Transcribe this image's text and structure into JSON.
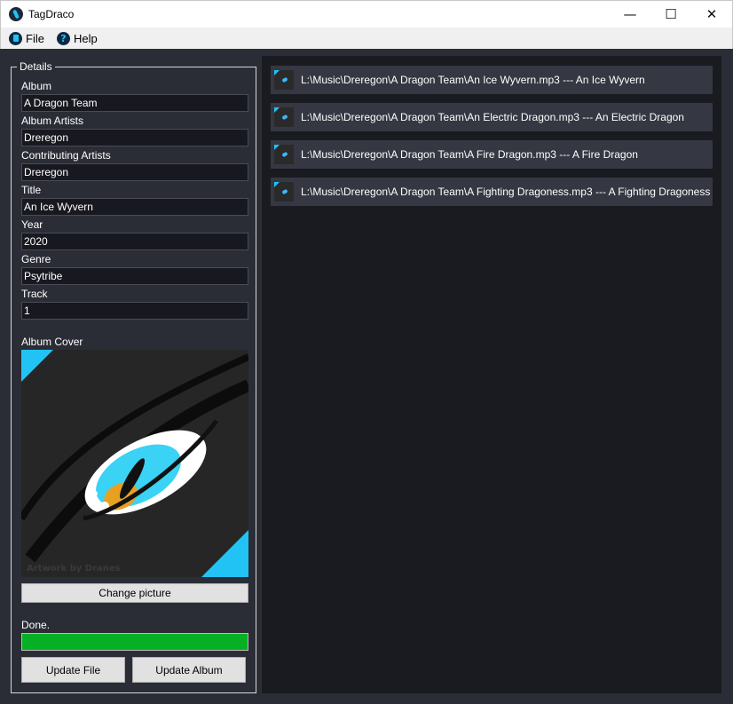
{
  "window": {
    "title": "TagDraco",
    "minimize": "—",
    "maximize": "☐",
    "close": "✕"
  },
  "menu": [
    {
      "label": "File",
      "icon": "file-icon"
    },
    {
      "label": "Help",
      "icon": "help-icon",
      "glyph": "?"
    }
  ],
  "details": {
    "legend": "Details",
    "fields": [
      {
        "label": "Album",
        "value": "A Dragon Team"
      },
      {
        "label": "Album Artists",
        "value": "Dreregon"
      },
      {
        "label": "Contributing Artists",
        "value": "Dreregon"
      },
      {
        "label": "Title",
        "value": "An Ice Wyvern"
      },
      {
        "label": "Year",
        "value": "2020"
      },
      {
        "label": "Genre",
        "value": "Psytribe"
      },
      {
        "label": "Track",
        "value": "1"
      }
    ],
    "cover_label": "Album Cover",
    "cover_watermark": "Artwork by Dranes",
    "change_picture": "Change picture",
    "status": "Done.",
    "progress": 1.0,
    "update_file": "Update File",
    "update_album": "Update Album"
  },
  "colors": {
    "accent": "#21c3f5",
    "progress": "#06b025",
    "panel": "#1a1b20",
    "item": "#353742"
  },
  "tracks": [
    {
      "text": "L:\\Music\\Dreregon\\A Dragon Team\\An Ice Wyvern.mp3  ---  An Ice Wyvern"
    },
    {
      "text": "L:\\Music\\Dreregon\\A Dragon Team\\An Electric Dragon.mp3  ---  An Electric Dragon"
    },
    {
      "text": "L:\\Music\\Dreregon\\A Dragon Team\\A Fire Dragon.mp3  ---  A Fire Dragon"
    },
    {
      "text": "L:\\Music\\Dreregon\\A Dragon Team\\A Fighting Dragoness.mp3  ---  A Fighting Dragoness"
    }
  ]
}
